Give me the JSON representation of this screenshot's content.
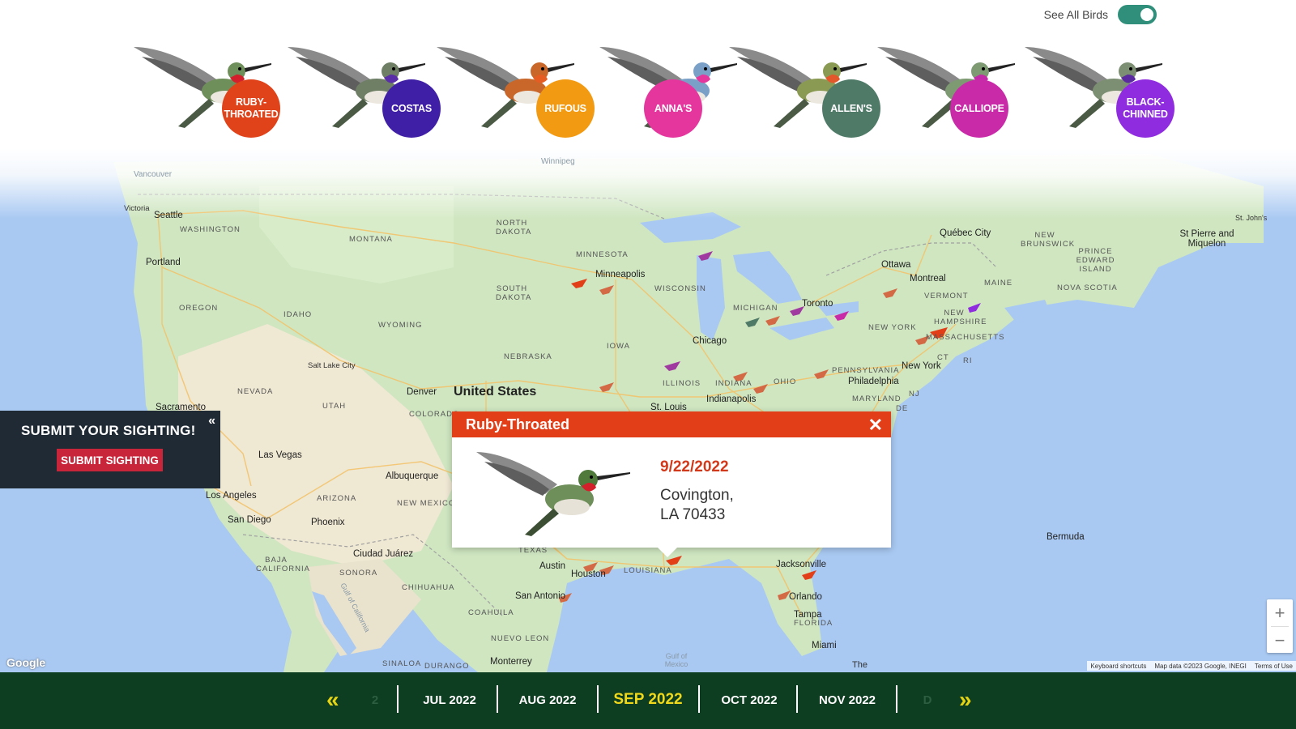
{
  "header": {
    "toggle_label": "See All Birds",
    "toggle_on": true
  },
  "birds": [
    {
      "label": "RUBY-\nTHROATED",
      "color": "#e0421a",
      "icon": "ruby-throated-hummingbird"
    },
    {
      "label": "COSTAS",
      "color": "#3f1fa6",
      "icon": "costas-hummingbird"
    },
    {
      "label": "RUFOUS",
      "color": "#f29a12",
      "icon": "rufous-hummingbird"
    },
    {
      "label": "ANNA'S",
      "color": "#e5369e",
      "icon": "annas-hummingbird"
    },
    {
      "label": "ALLEN'S",
      "color": "#4f7a68",
      "icon": "allens-hummingbird"
    },
    {
      "label": "CALLIOPE",
      "color": "#c92aa8",
      "icon": "calliope-hummingbird"
    },
    {
      "label": "BLACK-\nCHINNED",
      "color": "#8f2ce0",
      "icon": "black-chinned-hummingbird"
    }
  ],
  "submit": {
    "title": "SUBMIT YOUR SIGHTING!",
    "button": "SUBMIT SIGHTING",
    "collapse_icon": "«"
  },
  "popup": {
    "title": "Ruby-Throated",
    "date": "9/22/2022",
    "location": "Covington,\nLA 70433",
    "close_icon": "✕"
  },
  "map": {
    "country_label": "United States",
    "cities": [
      {
        "name": "Vancouver"
      },
      {
        "name": "Victoria"
      },
      {
        "name": "Seattle"
      },
      {
        "name": "Portland"
      },
      {
        "name": "Sacramento"
      },
      {
        "name": "Las Vegas"
      },
      {
        "name": "Los Angeles"
      },
      {
        "name": "San Diego"
      },
      {
        "name": "Phoenix"
      },
      {
        "name": "Salt Lake City"
      },
      {
        "name": "Denver"
      },
      {
        "name": "Albuquerque"
      },
      {
        "name": "Ciudad Juárez"
      },
      {
        "name": "Minneapolis"
      },
      {
        "name": "Chicago"
      },
      {
        "name": "St. Louis"
      },
      {
        "name": "Indianapolis"
      },
      {
        "name": "Toronto"
      },
      {
        "name": "Ottawa"
      },
      {
        "name": "Montreal"
      },
      {
        "name": "Québec City"
      },
      {
        "name": "New York"
      },
      {
        "name": "Philadelphia"
      },
      {
        "name": "Austin"
      },
      {
        "name": "Houston"
      },
      {
        "name": "San Antonio"
      },
      {
        "name": "Jacksonville"
      },
      {
        "name": "Orlando"
      },
      {
        "name": "Tampa"
      },
      {
        "name": "Miami"
      },
      {
        "name": "Monterrey"
      },
      {
        "name": "Bermuda"
      },
      {
        "name": "St Pierre and Miquelon"
      },
      {
        "name": "St. John's"
      },
      {
        "name": "Winnipeg"
      }
    ],
    "states": [
      {
        "name": "WASHINGTON"
      },
      {
        "name": "OREGON"
      },
      {
        "name": "IDAHO"
      },
      {
        "name": "MONTANA"
      },
      {
        "name": "WYOMING"
      },
      {
        "name": "NEVADA"
      },
      {
        "name": "UTAH"
      },
      {
        "name": "COLORADO"
      },
      {
        "name": "ARIZONA"
      },
      {
        "name": "NEW MEXICO"
      },
      {
        "name": "NORTH DAKOTA"
      },
      {
        "name": "SOUTH DAKOTA"
      },
      {
        "name": "NEBRASKA"
      },
      {
        "name": "MINNESOTA"
      },
      {
        "name": "IOWA"
      },
      {
        "name": "WISCONSIN"
      },
      {
        "name": "MICHIGAN"
      },
      {
        "name": "ILLINOIS"
      },
      {
        "name": "INDIANA"
      },
      {
        "name": "OHIO"
      },
      {
        "name": "PENNSYLVANIA"
      },
      {
        "name": "NEW YORK"
      },
      {
        "name": "MAINE"
      },
      {
        "name": "VERMONT"
      },
      {
        "name": "NEW HAMPSHIRE"
      },
      {
        "name": "MASSACHUSETTS"
      },
      {
        "name": "CT"
      },
      {
        "name": "RI"
      },
      {
        "name": "NJ"
      },
      {
        "name": "MARYLAND"
      },
      {
        "name": "DE"
      },
      {
        "name": "TEXAS"
      },
      {
        "name": "LOUISIANA"
      },
      {
        "name": "FLORIDA"
      },
      {
        "name": "BAJA CALIFORNIA"
      },
      {
        "name": "SONORA"
      },
      {
        "name": "CHIHUAHUA"
      },
      {
        "name": "COAHUILA"
      },
      {
        "name": "NUEVO LEON"
      },
      {
        "name": "SINALOA"
      },
      {
        "name": "DURANGO"
      },
      {
        "name": "NEW BRUNSWICK"
      },
      {
        "name": "PRINCE EDWARD ISLAND"
      },
      {
        "name": "NOVA SCOTIA"
      }
    ],
    "water": [
      {
        "name": "Gulf of California"
      },
      {
        "name": "Gulf of Mexico"
      },
      {
        "name": "The"
      }
    ],
    "google_logo": "Google",
    "attribution": [
      "Keyboard shortcuts",
      "Map data ©2023 Google, INEGI",
      "Terms of Use"
    ],
    "zoom_in": "+",
    "zoom_out": "−"
  },
  "timeline": {
    "prev_icon": "«",
    "next_icon": "»",
    "months": [
      {
        "label": "2",
        "state": "faded"
      },
      {
        "label": "JUL 2022",
        "state": "normal"
      },
      {
        "label": "AUG 2022",
        "state": "normal"
      },
      {
        "label": "SEP 2022",
        "state": "active"
      },
      {
        "label": "OCT 2022",
        "state": "normal"
      },
      {
        "label": "NOV 2022",
        "state": "normal"
      },
      {
        "label": "D",
        "state": "faded"
      }
    ]
  }
}
